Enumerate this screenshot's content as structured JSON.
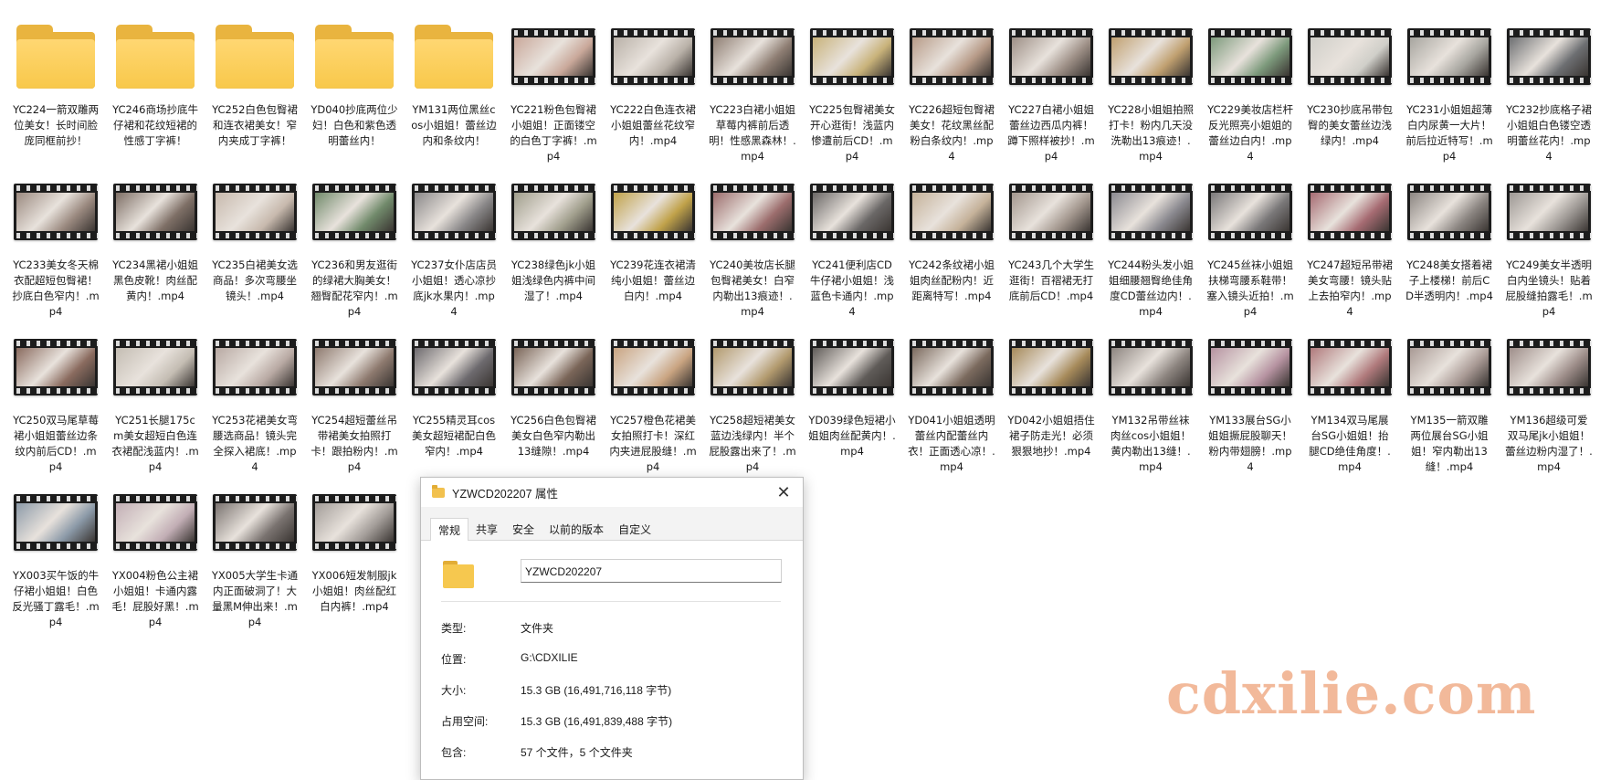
{
  "files": [
    {
      "type": "folder",
      "name": "YC224一箭双雕两位美女！长时间脸庞同框前抄！"
    },
    {
      "type": "folder",
      "name": "YC246商场抄底牛仔裙和花纹短裙的性感丁字裤！"
    },
    {
      "type": "folder",
      "name": "YC252白色包臀裙和连衣裙美女！窄内夹成丁字裤！"
    },
    {
      "type": "folder",
      "name": "YD040抄底两位少妇！白色和紫色透明蕾丝内！"
    },
    {
      "type": "folder",
      "name": "YM131两位黑丝cos小姐姐！蕾丝边内和条纹内！"
    },
    {
      "type": "video",
      "name": "YC221粉色包臀裙小姐姐！正面镂空的白色丁字裤！.mp4",
      "tint": "#c9a89a"
    },
    {
      "type": "video",
      "name": "YC222白色连衣裙小姐姐蕾丝花纹窄内！.mp4",
      "tint": "#b9b1a8"
    },
    {
      "type": "video",
      "name": "YC223白裙小姐姐草莓内裤前后透明！性感黑森林！.mp4",
      "tint": "#8f7f74"
    },
    {
      "type": "video",
      "name": "YC225包臀裙美女开心逛街！浅蓝内惨遭前后CD！.mp4",
      "tint": "#c8b27a"
    },
    {
      "type": "video",
      "name": "YC226超短包臀裙美女！花纹黑丝配粉白条纹内！.mp4",
      "tint": "#b79b88"
    },
    {
      "type": "video",
      "name": "YC227白裙小姐姐蕾丝边西瓜内裤！蹲下照样被抄！.mp4",
      "tint": "#9d8f86"
    },
    {
      "type": "video",
      "name": "YC228小姐姐拍照打卡！粉内几天没洗勒出13痕迹！.mp4",
      "tint": "#c0a070"
    },
    {
      "type": "video",
      "name": "YC229美妆店栏杆反光照亮小姐姐的蕾丝边白内！.mp4",
      "tint": "#7d9a7c"
    },
    {
      "type": "video",
      "name": "YC230抄底吊带包臀的美女蕾丝边浅绿内！.mp4",
      "tint": "#d0cfc9"
    },
    {
      "type": "video",
      "name": "YC231小姐姐超薄白内尿黄一大片！前后拉近特写！.mp4",
      "tint": "#a7a59f"
    },
    {
      "type": "video",
      "name": "YC232抄底格子裙小姐姐白色镂空透明蕾丝花内！.mp4",
      "tint": "#6d6f72"
    },
    {
      "type": "video",
      "name": "YC233美女冬天棉衣配超短包臀裙！抄底白色窄内！.mp4",
      "tint": "#9b8a80"
    },
    {
      "type": "video",
      "name": "YC234黑裙小姐姐黑色皮靴！肉丝配黄内！.mp4",
      "tint": "#7e6f66"
    },
    {
      "type": "video",
      "name": "YC235白裙美女选商品！多次弯腰坐镜头！.mp4",
      "tint": "#c7b9ad"
    },
    {
      "type": "video",
      "name": "YC236和男友逛街的绿裙大胸美女！翘臀配花窄内！.mp4",
      "tint": "#718a6b"
    },
    {
      "type": "video",
      "name": "YC237女仆店店员小姐姐！透心凉抄底jk水果内！.mp4",
      "tint": "#8a8889"
    },
    {
      "type": "video",
      "name": "YC238绿色jk小姐姐浅绿色内裤中间湿了！.mp4",
      "tint": "#a09e8c"
    },
    {
      "type": "video",
      "name": "YC239花连衣裙清纯小姐姐！蕾丝边白内！.mp4",
      "tint": "#c0a24a"
    },
    {
      "type": "video",
      "name": "YC240美妆店长腿包臀裙美女！白窄内勒出13痕迹！.mp4",
      "tint": "#9c6d6d"
    },
    {
      "type": "video",
      "name": "YC241便利店CD牛仔裙小姐姐！浅蓝色卡通内！.mp4",
      "tint": "#6a6766"
    },
    {
      "type": "video",
      "name": "YC242条纹裙小姐姐肉丝配粉内！近距离特写！.mp4",
      "tint": "#c5b29a"
    },
    {
      "type": "video",
      "name": "YC243几个大学生逛街！百褶裙无打底前后CD！.mp4",
      "tint": "#a3978e"
    },
    {
      "type": "video",
      "name": "YC244粉头发小姐姐细腰翘臀绝佳角度CD蕾丝边内！.mp4",
      "tint": "#8b8a90"
    },
    {
      "type": "video",
      "name": "YC245丝袜小姐姐扶梯弯腰系鞋带！塞入镜头近拍！.mp4",
      "tint": "#7a7879"
    },
    {
      "type": "video",
      "name": "YC247超短吊带裙美女弯腰！镜头贴上去拍窄内！.mp4",
      "tint": "#a66b72"
    },
    {
      "type": "video",
      "name": "YC248美女搭着裙子上楼梯！前后CD半透明内！.mp4",
      "tint": "#8c8682"
    },
    {
      "type": "video",
      "name": "YC249美女半透明白内坐镜头！贴着屁股缝拍露毛！.mp4",
      "tint": "#9d9894"
    },
    {
      "type": "video",
      "name": "YC250双马尾草莓裙小姐姐蕾丝边条纹内前后CD！.mp4",
      "tint": "#8a6b5f"
    },
    {
      "type": "video",
      "name": "YC251长腿175cm美女超短白色连衣裙配浅蓝内！.mp4",
      "tint": "#c4bdb3"
    },
    {
      "type": "video",
      "name": "YC253花裙美女弯腰选商品！镜头完全探入裙底！.mp4",
      "tint": "#b8a9a3"
    },
    {
      "type": "video",
      "name": "YC254超短蕾丝吊带裙美女拍照打卡！跟拍粉内！.mp4",
      "tint": "#8e7a6f"
    },
    {
      "type": "video",
      "name": "YC255精灵耳cos美女超短裙配白色窄内！.mp4",
      "tint": "#6d6a6e"
    },
    {
      "type": "video",
      "name": "YC256白色包臀裙美女白色窄内勒出13缝隙！.mp4",
      "tint": "#7a6558"
    },
    {
      "type": "video",
      "name": "YC257橙色花裙美女拍照打卡！深红内夹进屁股缝！.mp4",
      "tint": "#c9a481"
    },
    {
      "type": "video",
      "name": "YC258超短裙美女蓝边浅绿内！半个屁股露出来了！.mp4",
      "tint": "#b29a6e"
    },
    {
      "type": "video",
      "name": "YD039绿色短裙小姐姐肉丝配黄内！.mp4",
      "tint": "#5f5b58"
    },
    {
      "type": "video",
      "name": "YD041小姐姐透明蕾丝内配蕾丝内衣！正面透心凉！.mp4",
      "tint": "#7b6a5e"
    },
    {
      "type": "video",
      "name": "YD042小姐姐捂住裙子防走光！必须狠狠地抄！.mp4",
      "tint": "#a68a5a"
    },
    {
      "type": "video",
      "name": "YM132吊带丝袜肉丝cos小姐姐！黄内勒出13缝！.mp4",
      "tint": "#8d8580"
    },
    {
      "type": "video",
      "name": "YM133展台SG小姐姐撅屁股聊天！粉内带翅膀！.mp4",
      "tint": "#b693a1"
    },
    {
      "type": "video",
      "name": "YM134双马尾展台SG小姐姐！抬腿CD绝佳角度！.mp4",
      "tint": "#b07a7c"
    },
    {
      "type": "video",
      "name": "YM135一箭双雕两位展台SG小姐姐！窄内勒出13缝！.mp4",
      "tint": "#a99a95"
    },
    {
      "type": "video",
      "name": "YM136超级可爱双马尾jk小姐姐！蕾丝边粉内湿了！.mp4",
      "tint": "#9e8e8a"
    },
    {
      "type": "video",
      "name": "YX003买午饭的牛仔裙小姐姐！白色反光骚丁露毛！.mp4",
      "tint": "#8c9aa8"
    },
    {
      "type": "video",
      "name": "YX004粉色公主裙小姐姐！卡通内露毛！屁股好黑！.mp4",
      "tint": "#c2aeb5"
    },
    {
      "type": "video",
      "name": "YX005大学生卡通内正面破洞了！大量黑M伸出来！.mp4",
      "tint": "#7a7370"
    },
    {
      "type": "video",
      "name": "YX006短发制服jk小姐姐！肉丝配红白内裤！.mp4",
      "tint": "#a29c98"
    }
  ],
  "dialog": {
    "title": "YZWCD202207 属性",
    "tabs": [
      "常规",
      "共享",
      "安全",
      "以前的版本",
      "自定义"
    ],
    "active_tab": "常规",
    "folder_name": "YZWCD202207",
    "rows": [
      {
        "label": "类型:",
        "value": "文件夹"
      },
      {
        "label": "位置:",
        "value": "G:\\CDXILIE"
      },
      {
        "label": "大小:",
        "value": "15.3 GB (16,491,716,118 字节)"
      },
      {
        "label": "占用空间:",
        "value": "15.3 GB (16,491,839,488 字节)"
      },
      {
        "label": "包含:",
        "value": "57 个文件，5 个文件夹"
      }
    ]
  },
  "watermark": "cdxilie.com"
}
